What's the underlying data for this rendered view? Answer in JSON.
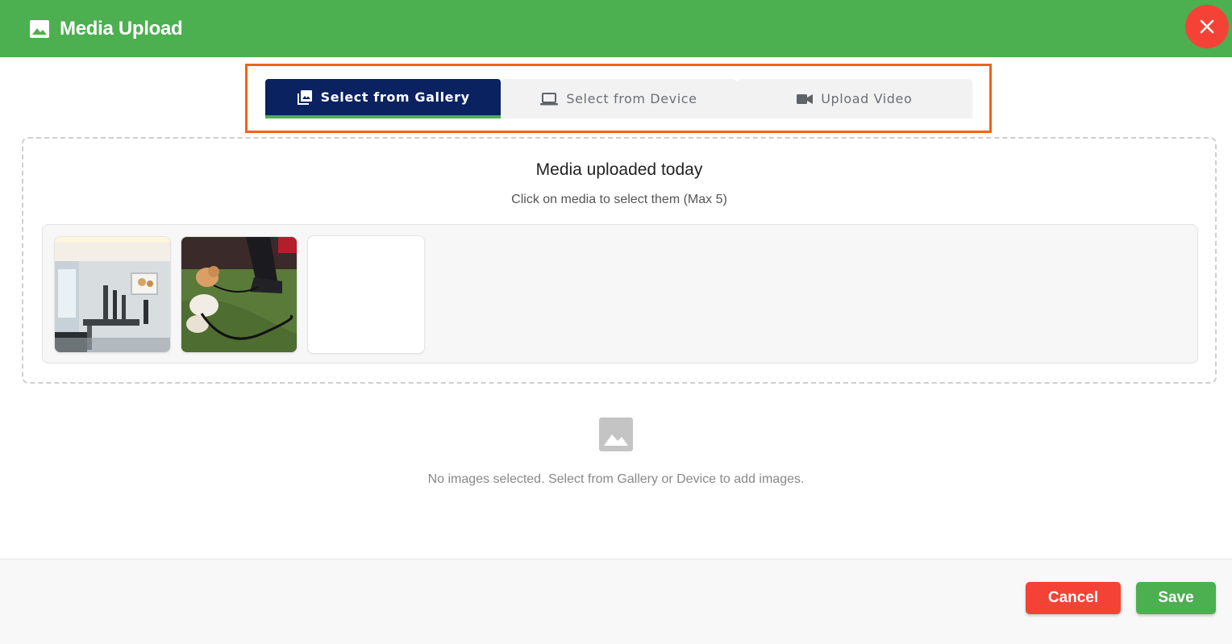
{
  "header": {
    "title": "Media Upload",
    "icon": "image-icon",
    "close_icon": "close-icon"
  },
  "tabs": [
    {
      "label": "Select from Gallery",
      "icon": "photo-library-icon",
      "active": true
    },
    {
      "label": "Select from Device",
      "icon": "laptop-icon",
      "active": false
    },
    {
      "label": "Upload Video",
      "icon": "videocam-icon",
      "active": false
    }
  ],
  "gallery": {
    "title": "Media uploaded today",
    "subtitle": "Click on media to select them (Max 5)",
    "items": [
      {
        "kind": "photo",
        "description_icon": "grooming-room-photo"
      },
      {
        "kind": "photo",
        "description_icon": "dogs-on-turf-photo"
      },
      {
        "kind": "blank"
      }
    ]
  },
  "empty_state": {
    "icon": "image-placeholder-icon",
    "text": "No images selected. Select from Gallery or Device to add images."
  },
  "footer": {
    "cancel_label": "Cancel",
    "save_label": "Save"
  },
  "colors": {
    "header_green": "#4caf50",
    "close_red": "#f44336",
    "tab_active_navy": "#0a2260",
    "highlight_orange": "#f06414"
  }
}
